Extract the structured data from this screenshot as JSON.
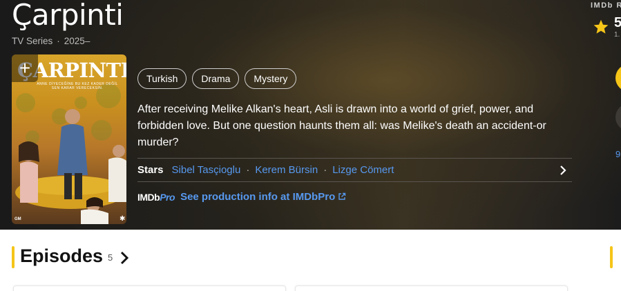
{
  "header": {
    "title": "Çarpinti",
    "type": "TV Series",
    "years": "2025–"
  },
  "rating": {
    "label": "IMDb R",
    "value": "5",
    "count": "1.",
    "side_link": "9"
  },
  "poster": {
    "add_label": "+",
    "title_text": "ÇARPINTI",
    "tagline": "ANNE DİYECEĞİNE BU KEZ KADER DEĞİL SEN KARAR VERECEKSİN.",
    "logo": "GM",
    "mark": "✱"
  },
  "genres": [
    "Turkish",
    "Drama",
    "Mystery"
  ],
  "plot": "After receiving Melike Alkan's heart, Asli is drawn into a world of grief, power, and forbidden love. But one question haunts them all: was Melike's death an accident-or murder?",
  "stars": {
    "label": "Stars",
    "names": [
      "Sibel Tasçioglu",
      "Kerem Bürsin",
      "Lizge Cömert"
    ]
  },
  "imdbpro": {
    "logo_a": "IMDb",
    "logo_b": "Pro",
    "link": "See production info at IMDbPro"
  },
  "episodes": {
    "title": "Episodes",
    "count": "5"
  },
  "colors": {
    "accent": "#f5c518",
    "link": "#5799ef"
  }
}
